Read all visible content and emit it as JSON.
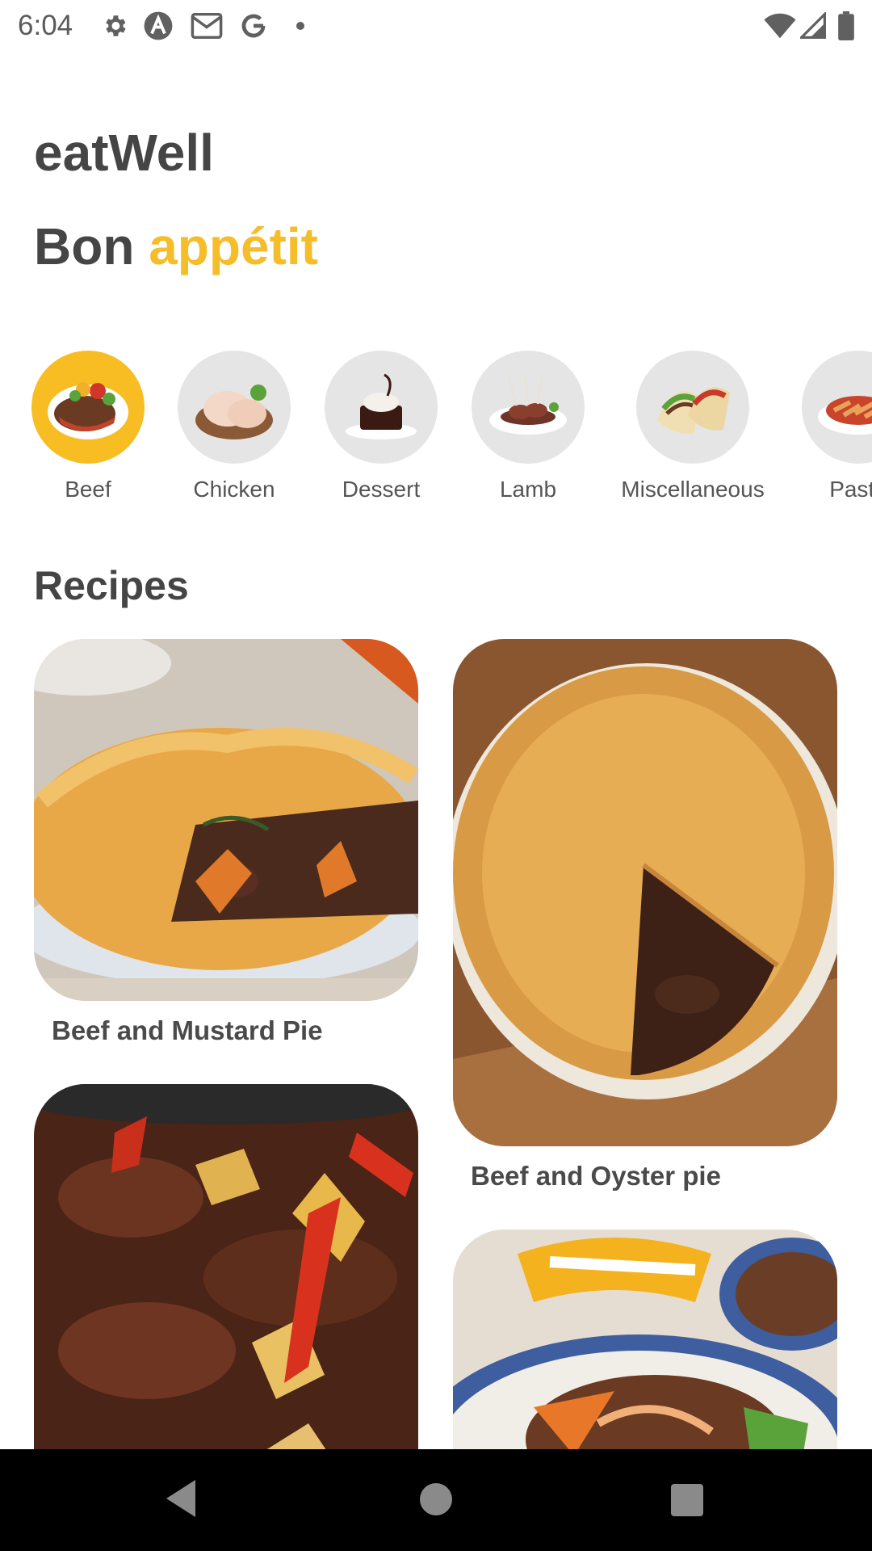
{
  "status_bar": {
    "time": "6:04",
    "left_icons": [
      "settings-icon",
      "a-logo-icon",
      "gmail-icon",
      "google-icon",
      "dot-icon"
    ],
    "right_icons": [
      "wifi-icon",
      "cell-signal-icon",
      "battery-icon"
    ]
  },
  "header": {
    "app_name": "eatWell",
    "greeting_plain": "Bon",
    "greeting_accent": "appétit"
  },
  "categories": [
    {
      "label": "Beef",
      "selected": true,
      "icon": "beef-thumbnail"
    },
    {
      "label": "Chicken",
      "selected": false,
      "icon": "chicken-thumbnail"
    },
    {
      "label": "Dessert",
      "selected": false,
      "icon": "dessert-thumbnail"
    },
    {
      "label": "Lamb",
      "selected": false,
      "icon": "lamb-thumbnail"
    },
    {
      "label": "Miscellaneous",
      "selected": false,
      "icon": "miscellaneous-thumbnail"
    },
    {
      "label": "Pasta",
      "selected": false,
      "icon": "pasta-thumbnail"
    }
  ],
  "recipes_section": {
    "title": "Recipes",
    "items": [
      {
        "name": "Beef and Mustard Pie"
      },
      {
        "name": "Beef and Oyster pie"
      },
      {
        "name": ""
      },
      {
        "name": ""
      }
    ]
  },
  "nav_bar": {
    "buttons": [
      "back-icon",
      "home-icon",
      "recents-icon"
    ]
  },
  "colors": {
    "accent": "#f6bd2a",
    "title": "#454545",
    "nav_bg": "#000000",
    "chip_bg": "#e5e5e5"
  }
}
